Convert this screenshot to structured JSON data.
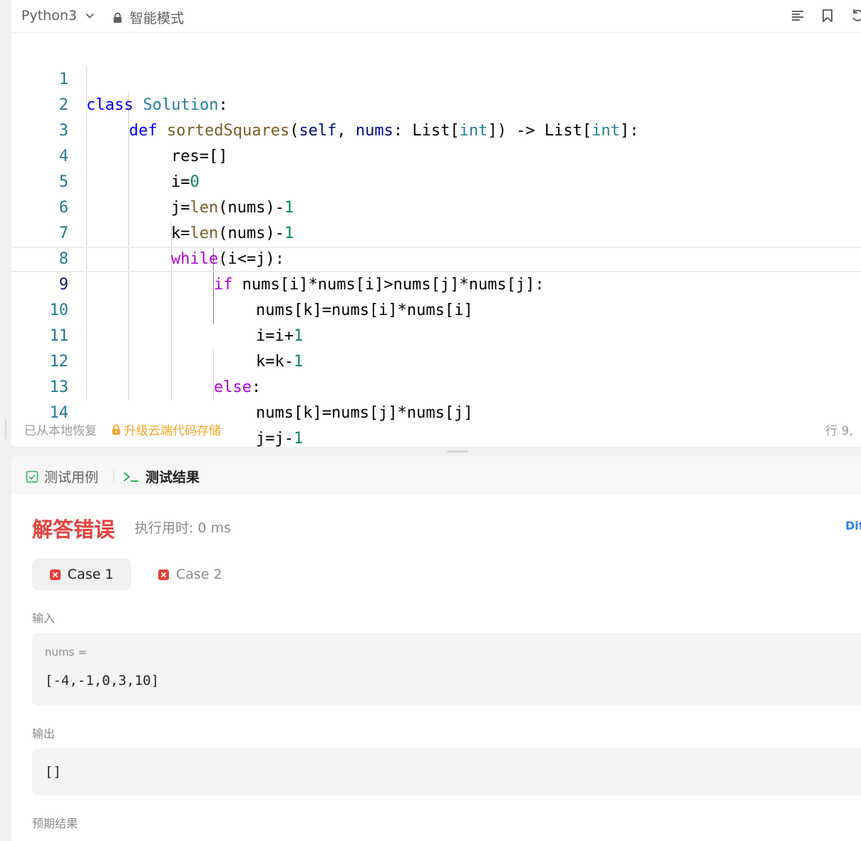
{
  "toolbar": {
    "language": "Python3",
    "mode": "智能模式",
    "icons": [
      "format-icon",
      "bookmark-icon",
      "reset-icon"
    ]
  },
  "code": {
    "lines": [
      {
        "n": "1"
      },
      {
        "n": "2"
      },
      {
        "n": "3"
      },
      {
        "n": "4"
      },
      {
        "n": "5"
      },
      {
        "n": "6"
      },
      {
        "n": "7"
      },
      {
        "n": "8"
      },
      {
        "n": "9"
      },
      {
        "n": "10"
      },
      {
        "n": "11"
      },
      {
        "n": "12"
      },
      {
        "n": "13"
      },
      {
        "n": "14"
      }
    ],
    "tokens": {
      "l1": [
        "class",
        " ",
        "Solution",
        ":"
      ],
      "l2": [
        "def",
        " ",
        "sortedSquares",
        "(",
        "self",
        ", ",
        "nums",
        ": List[",
        "int",
        "]) -> List[",
        "int",
        "]:"
      ],
      "l3": [
        "res=[]"
      ],
      "l4": [
        "i=",
        "0"
      ],
      "l5": [
        "j=",
        "len",
        "(nums)-",
        "1"
      ],
      "l6": [
        "k=",
        "len",
        "(nums)-",
        "1"
      ],
      "l7": [
        "while",
        "(i<=j):"
      ],
      "l8": [
        "if",
        " nums[i]*nums[i]>nums[j]*nums[j]:"
      ],
      "l9": [
        "nums[k]=nums[i]*nums[i]"
      ],
      "l10": [
        "i=i+",
        "1"
      ],
      "l11": [
        "k=k-",
        "1"
      ],
      "l12": [
        "else",
        ":"
      ],
      "l13": [
        "nums[k]=nums[j]*nums[j]"
      ],
      "l14": [
        "j=j-",
        "1"
      ]
    }
  },
  "status": {
    "restored": "已从本地恢复",
    "upgrade": "升级云端代码存储",
    "cursor": "行 9,"
  },
  "results": {
    "tab_cases": "测试用例",
    "tab_results": "测试结果",
    "verdict": "解答错误",
    "runtime": "执行用时: 0 ms",
    "diff": "Diff",
    "case1": "Case 1",
    "case2": "Case 2",
    "input_label": "输入",
    "input_var": "nums =",
    "input_value": "[-4,-1,0,3,10]",
    "output_label": "输出",
    "output_value": "[]",
    "expected_label": "预期结果"
  },
  "colors": {
    "error": "#e5413d",
    "warning": "#f5a623",
    "accent": "#2f7ef0",
    "line_number": "#237893"
  }
}
